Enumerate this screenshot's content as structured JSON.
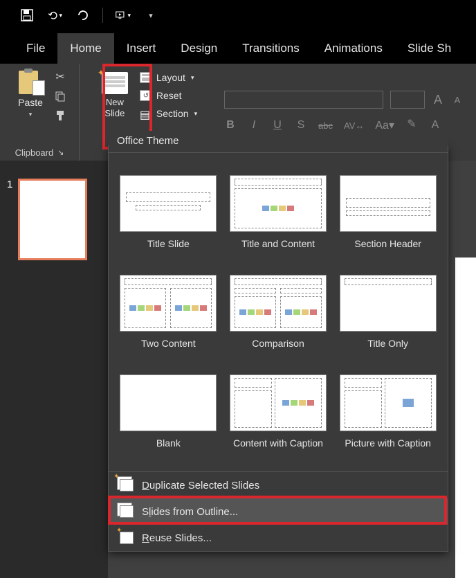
{
  "qat": {
    "icons": [
      "save-icon",
      "undo-icon",
      "redo-icon",
      "start-from-beginning-icon",
      "customize-icon"
    ]
  },
  "tabs": {
    "items": [
      "File",
      "Home",
      "Insert",
      "Design",
      "Transitions",
      "Animations",
      "Slide Sh"
    ],
    "active": 1
  },
  "ribbon": {
    "clipboard": {
      "paste": "Paste",
      "label": "Clipboard"
    },
    "slides": {
      "newslide": "New\nSlide",
      "layout": "Layout",
      "reset": "Reset",
      "section": "Section"
    },
    "font": {
      "bold": "B",
      "italic": "I",
      "underline": "U",
      "shadow": "S",
      "strike": "abc",
      "spacing": "AV",
      "case": "Aa",
      "increase": "A",
      "decrease": "A"
    }
  },
  "slide_panel": {
    "slides": [
      {
        "number": "1"
      }
    ]
  },
  "dropdown": {
    "header": "Office Theme",
    "layouts": [
      {
        "name": "Title Slide"
      },
      {
        "name": "Title and Content"
      },
      {
        "name": "Section Header"
      },
      {
        "name": "Two Content"
      },
      {
        "name": "Comparison"
      },
      {
        "name": "Title Only"
      },
      {
        "name": "Blank"
      },
      {
        "name": "Content with Caption"
      },
      {
        "name": "Picture with Caption"
      }
    ],
    "menu": {
      "duplicate": "Duplicate Selected Slides",
      "outline": "Slides from Outline...",
      "reuse": "Reuse Slides..."
    }
  }
}
